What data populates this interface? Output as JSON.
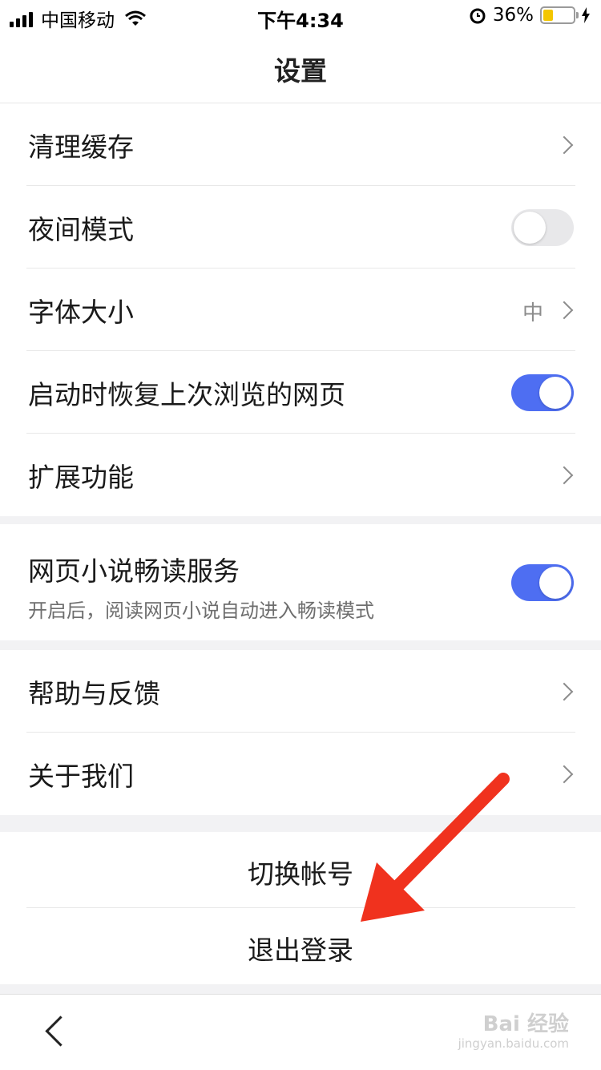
{
  "status_bar": {
    "carrier": "中国移动",
    "time": "下午4:34",
    "battery_percent": "36%",
    "battery_level": 0.36,
    "icons": [
      "signal-icon",
      "wifi-icon",
      "alarm-icon",
      "battery-icon",
      "charging-icon"
    ]
  },
  "header": {
    "title": "设置"
  },
  "group1": {
    "items": [
      {
        "label": "清理缓存"
      },
      {
        "label": "夜间模式",
        "toggle": false
      },
      {
        "label": "字体大小",
        "value": "中"
      },
      {
        "label": "启动时恢复上次浏览的网页",
        "toggle": true
      },
      {
        "label": "扩展功能"
      }
    ]
  },
  "group2": {
    "label": "网页小说畅读服务",
    "sublabel": "开启后，阅读网页小说自动进入畅读模式",
    "toggle": true
  },
  "group3": {
    "items": [
      {
        "label": "帮助与反馈"
      },
      {
        "label": "关于我们"
      }
    ]
  },
  "account": {
    "switch_label": "切换帐号",
    "logout_label": "退出登录"
  },
  "bottom_bar": {
    "watermark": "Bai 经验",
    "watermark_url": "jingyan.baidu.com"
  },
  "colors": {
    "accent": "#4e6ef2",
    "arrow": "#f0321e",
    "background": "#f2f2f4"
  }
}
